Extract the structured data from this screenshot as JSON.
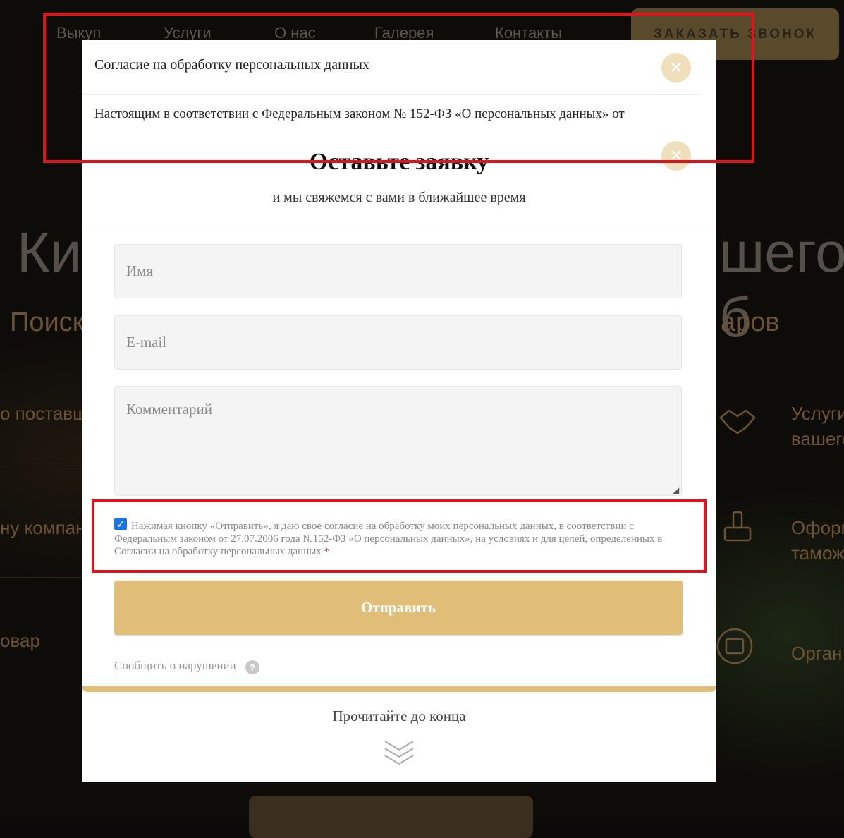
{
  "nav": {
    "items": [
      "Выкуп",
      "Услуги",
      "О нас",
      "Галерея",
      "Контакты"
    ],
    "order_button": "ЗАКАЗАТЬ ЗВОНОК"
  },
  "background": {
    "hero_title_left": "Ки",
    "hero_title_right": "шего б",
    "hero_sub_left": "Поиск",
    "hero_sub_right": "аров",
    "left_items": [
      "о поставщ",
      "ну компан",
      "овар"
    ],
    "right_items": [
      "Услуги\nвашего",
      "Оформ\nтамож",
      "Орган"
    ]
  },
  "consent": {
    "title": "Согласие на обработку персональных данных",
    "text": "Настоящим в соответствии с Федеральным законом № 152-ФЗ «О персональных данных» от"
  },
  "form": {
    "title": "Оставьте заявку",
    "subtitle": "и мы свяжемся с вами в ближайшее время",
    "name_placeholder": "Имя",
    "email_placeholder": "E-mail",
    "comment_placeholder": "Комментарий",
    "agree_checked": true,
    "agree_text": "Нажимая кнопку «Отправить», я даю свое согласие на обработку моих персональных данных, в соответствии с Федеральным законом от 27.07.2006 года №152-ФЗ «О персональных данных», на условиях и для целей, определенных в Согласии на обработку персональных данных",
    "required_mark": "*",
    "submit_label": "Отправить",
    "report_link": "Сообщить о нарушении",
    "help_icon_glyph": "?",
    "read_more": "Прочитайте до конца"
  },
  "colors": {
    "accent_gold": "#e0be78",
    "close_bg": "#efe0bb",
    "checkbox_blue": "#1a73e8",
    "annotation_red": "#e0121c"
  },
  "icons": {
    "close": "close-icon",
    "help": "help-icon",
    "chevrons": "chevrons-down-icon",
    "check": "check-icon"
  }
}
